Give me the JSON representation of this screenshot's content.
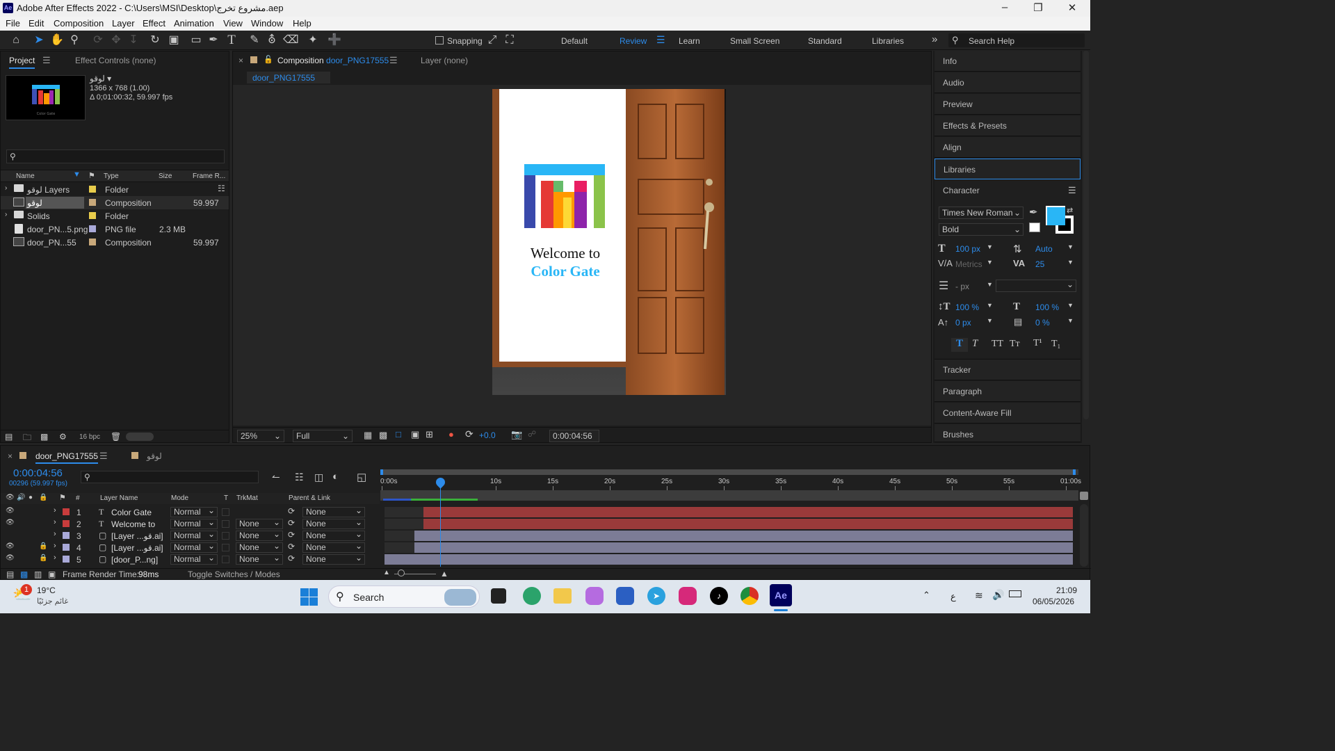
{
  "titlebar": {
    "title": "Adobe After Effects 2022 - C:\\Users\\MSI\\Desktop\\مشروع تخرج.aep",
    "app_icon": "Ae"
  },
  "menu": [
    "File",
    "Edit",
    "Composition",
    "Layer",
    "Effect",
    "Animation",
    "View",
    "Window",
    "Help"
  ],
  "toolbar": {
    "snapping": "Snapping",
    "workspaces": [
      "Default",
      "Review",
      "Learn",
      "Small Screen",
      "Standard",
      "Libraries"
    ],
    "search_placeholder": "Search Help"
  },
  "project": {
    "tabs": [
      "Project",
      "Effect Controls (none)"
    ],
    "preview_name": "لوقو ▾",
    "preview_size": "1366 x 768 (1.00)",
    "preview_dur": "Δ 0;01:00:32, 59.997 fps",
    "columns": [
      "Name",
      "Type",
      "Size",
      "Frame R..."
    ],
    "items": [
      {
        "name": "لوقو Layers",
        "type": "Folder",
        "size": "",
        "fps": ""
      },
      {
        "name": "لوقو",
        "type": "Composition",
        "size": "",
        "fps": "59.997"
      },
      {
        "name": "Solids",
        "type": "Folder",
        "size": "",
        "fps": ""
      },
      {
        "name": "door_PN...5.png",
        "type": "PNG file",
        "size": "2.3 MB",
        "fps": ""
      },
      {
        "name": "door_PN...55",
        "type": "Composition",
        "size": "",
        "fps": "59.997"
      }
    ],
    "bpc": "16 bpc"
  },
  "composition": {
    "tab_prefix": "Composition",
    "tab_name": "door_PNG17555",
    "layer_tab": "Layer  (none)",
    "subtab": "door_PNG17555",
    "welcome": "Welcome to",
    "brand": "Color Gate",
    "zoom": "25%",
    "quality": "Full",
    "exposure": "+0.0",
    "timecode": "0:00:04:56"
  },
  "right_panels": [
    "Info",
    "Audio",
    "Preview",
    "Effects & Presets",
    "Align",
    "Libraries",
    "Character",
    "Tracker",
    "Paragraph",
    "Content-Aware Fill",
    "Brushes"
  ],
  "character": {
    "font": "Times New Roman",
    "style": "Bold",
    "size": "100 px",
    "leading": "Auto",
    "kerning": "Metrics",
    "tracking": "25",
    "stroke": "- px",
    "vscale": "100 %",
    "hscale": "100 %",
    "baseline": "0 px",
    "tsume": "0 %",
    "fill_color": "#29b6f6"
  },
  "timeline": {
    "tabs": [
      "door_PNG17555",
      "لوقو"
    ],
    "timecode": "0:00:04:56",
    "frames": "00296 (59.997 fps)",
    "columns": [
      "#",
      "Layer Name",
      "Mode",
      "T",
      "TrkMat",
      "Parent & Link"
    ],
    "ruler": [
      "0:00s",
      "10s",
      "15s",
      "20s",
      "25s",
      "30s",
      "35s",
      "40s",
      "45s",
      "50s",
      "55s",
      "01:00s"
    ],
    "layers": [
      {
        "num": "1",
        "name": "Color Gate",
        "mode": "Normal",
        "trkmat": "",
        "parent": "None",
        "color": "#c83c3c"
      },
      {
        "num": "2",
        "name": "Welcome to",
        "mode": "Normal",
        "trkmat": "None",
        "parent": "None",
        "color": "#c83c3c"
      },
      {
        "num": "3",
        "name": "[Layer ...قو.ai]",
        "mode": "Normal",
        "trkmat": "None",
        "parent": "None",
        "color": "#a9a9d8"
      },
      {
        "num": "4",
        "name": "[Layer ...قو.ai]",
        "mode": "Normal",
        "trkmat": "None",
        "parent": "None",
        "color": "#a9a9d8"
      },
      {
        "num": "5",
        "name": "[door_P...ng]",
        "mode": "Normal",
        "trkmat": "None",
        "parent": "None",
        "color": "#a9a9d8"
      }
    ],
    "render_label": "Frame Render Time:",
    "render_time": "98ms",
    "toggle": "Toggle Switches / Modes"
  },
  "taskbar": {
    "temp": "19°C",
    "weather": "غائم جزئيًا",
    "badge": "1",
    "search": "Search",
    "time": "21:09",
    "date": "06/05/2026",
    "lang": "ع"
  }
}
